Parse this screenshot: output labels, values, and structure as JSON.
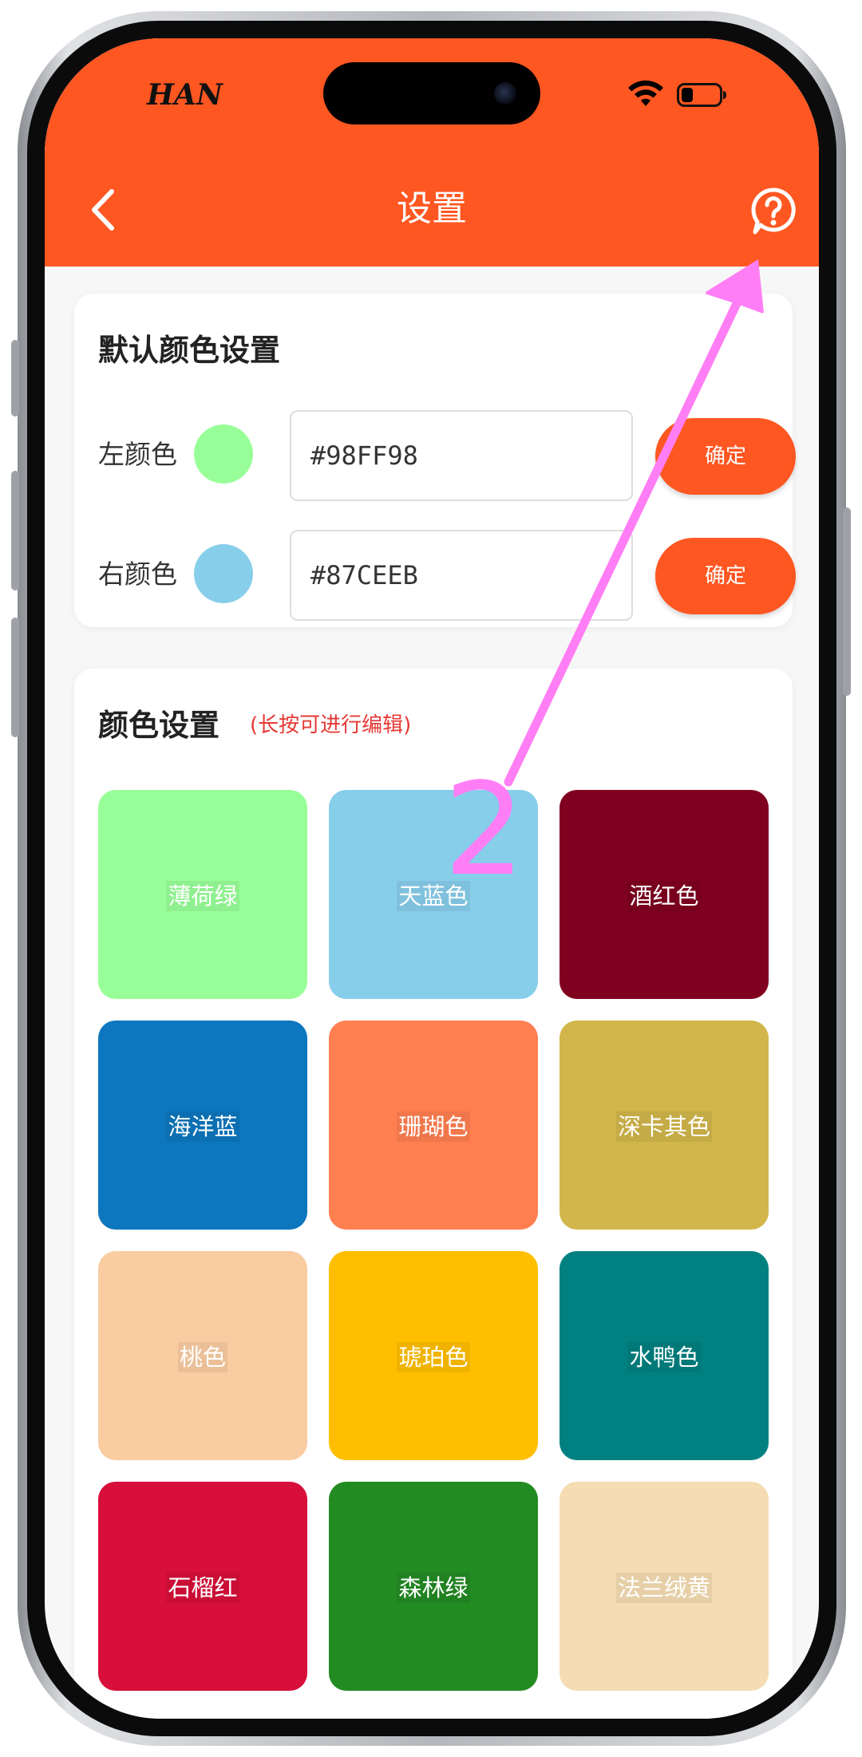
{
  "status_bar": {
    "carrier_logo": "HAN",
    "wifi_icon": "wifi-icon",
    "battery_icon": "battery-icon"
  },
  "header": {
    "title": "设置",
    "back_icon": "chevron-left-icon",
    "help_icon": "question-circle-icon",
    "background": "#ff5722"
  },
  "default_colors": {
    "title": "默认颜色设置",
    "left": {
      "label": "左颜色",
      "value": "#98FF98",
      "swatch": "#98FF98",
      "button": "确定"
    },
    "right": {
      "label": "右颜色",
      "value": "#87CEEB",
      "swatch": "#87CEEB",
      "button": "确定"
    }
  },
  "color_settings": {
    "title": "颜色设置",
    "hint": "(长按可进行编辑)",
    "colors": [
      {
        "name": "薄荷绿",
        "hex": "#98FF98"
      },
      {
        "name": "天蓝色",
        "hex": "#87CEEB"
      },
      {
        "name": "酒红色",
        "hex": "#800020"
      },
      {
        "name": "海洋蓝",
        "hex": "#0C76BE"
      },
      {
        "name": "珊瑚色",
        "hex": "#FF7F50"
      },
      {
        "name": "深卡其色",
        "hex": "#D2B64B"
      },
      {
        "name": "桃色",
        "hex": "#FACCA2"
      },
      {
        "name": "琥珀色",
        "hex": "#FFBF00"
      },
      {
        "name": "水鸭色",
        "hex": "#008080"
      },
      {
        "name": "石榴红",
        "hex": "#D70F3A"
      },
      {
        "name": "森林绿",
        "hex": "#228B22"
      },
      {
        "name": "法兰绒黄",
        "hex": "#F5DCB2"
      }
    ]
  },
  "annotation": {
    "step_number": "2",
    "color": "#ff7ef5"
  }
}
